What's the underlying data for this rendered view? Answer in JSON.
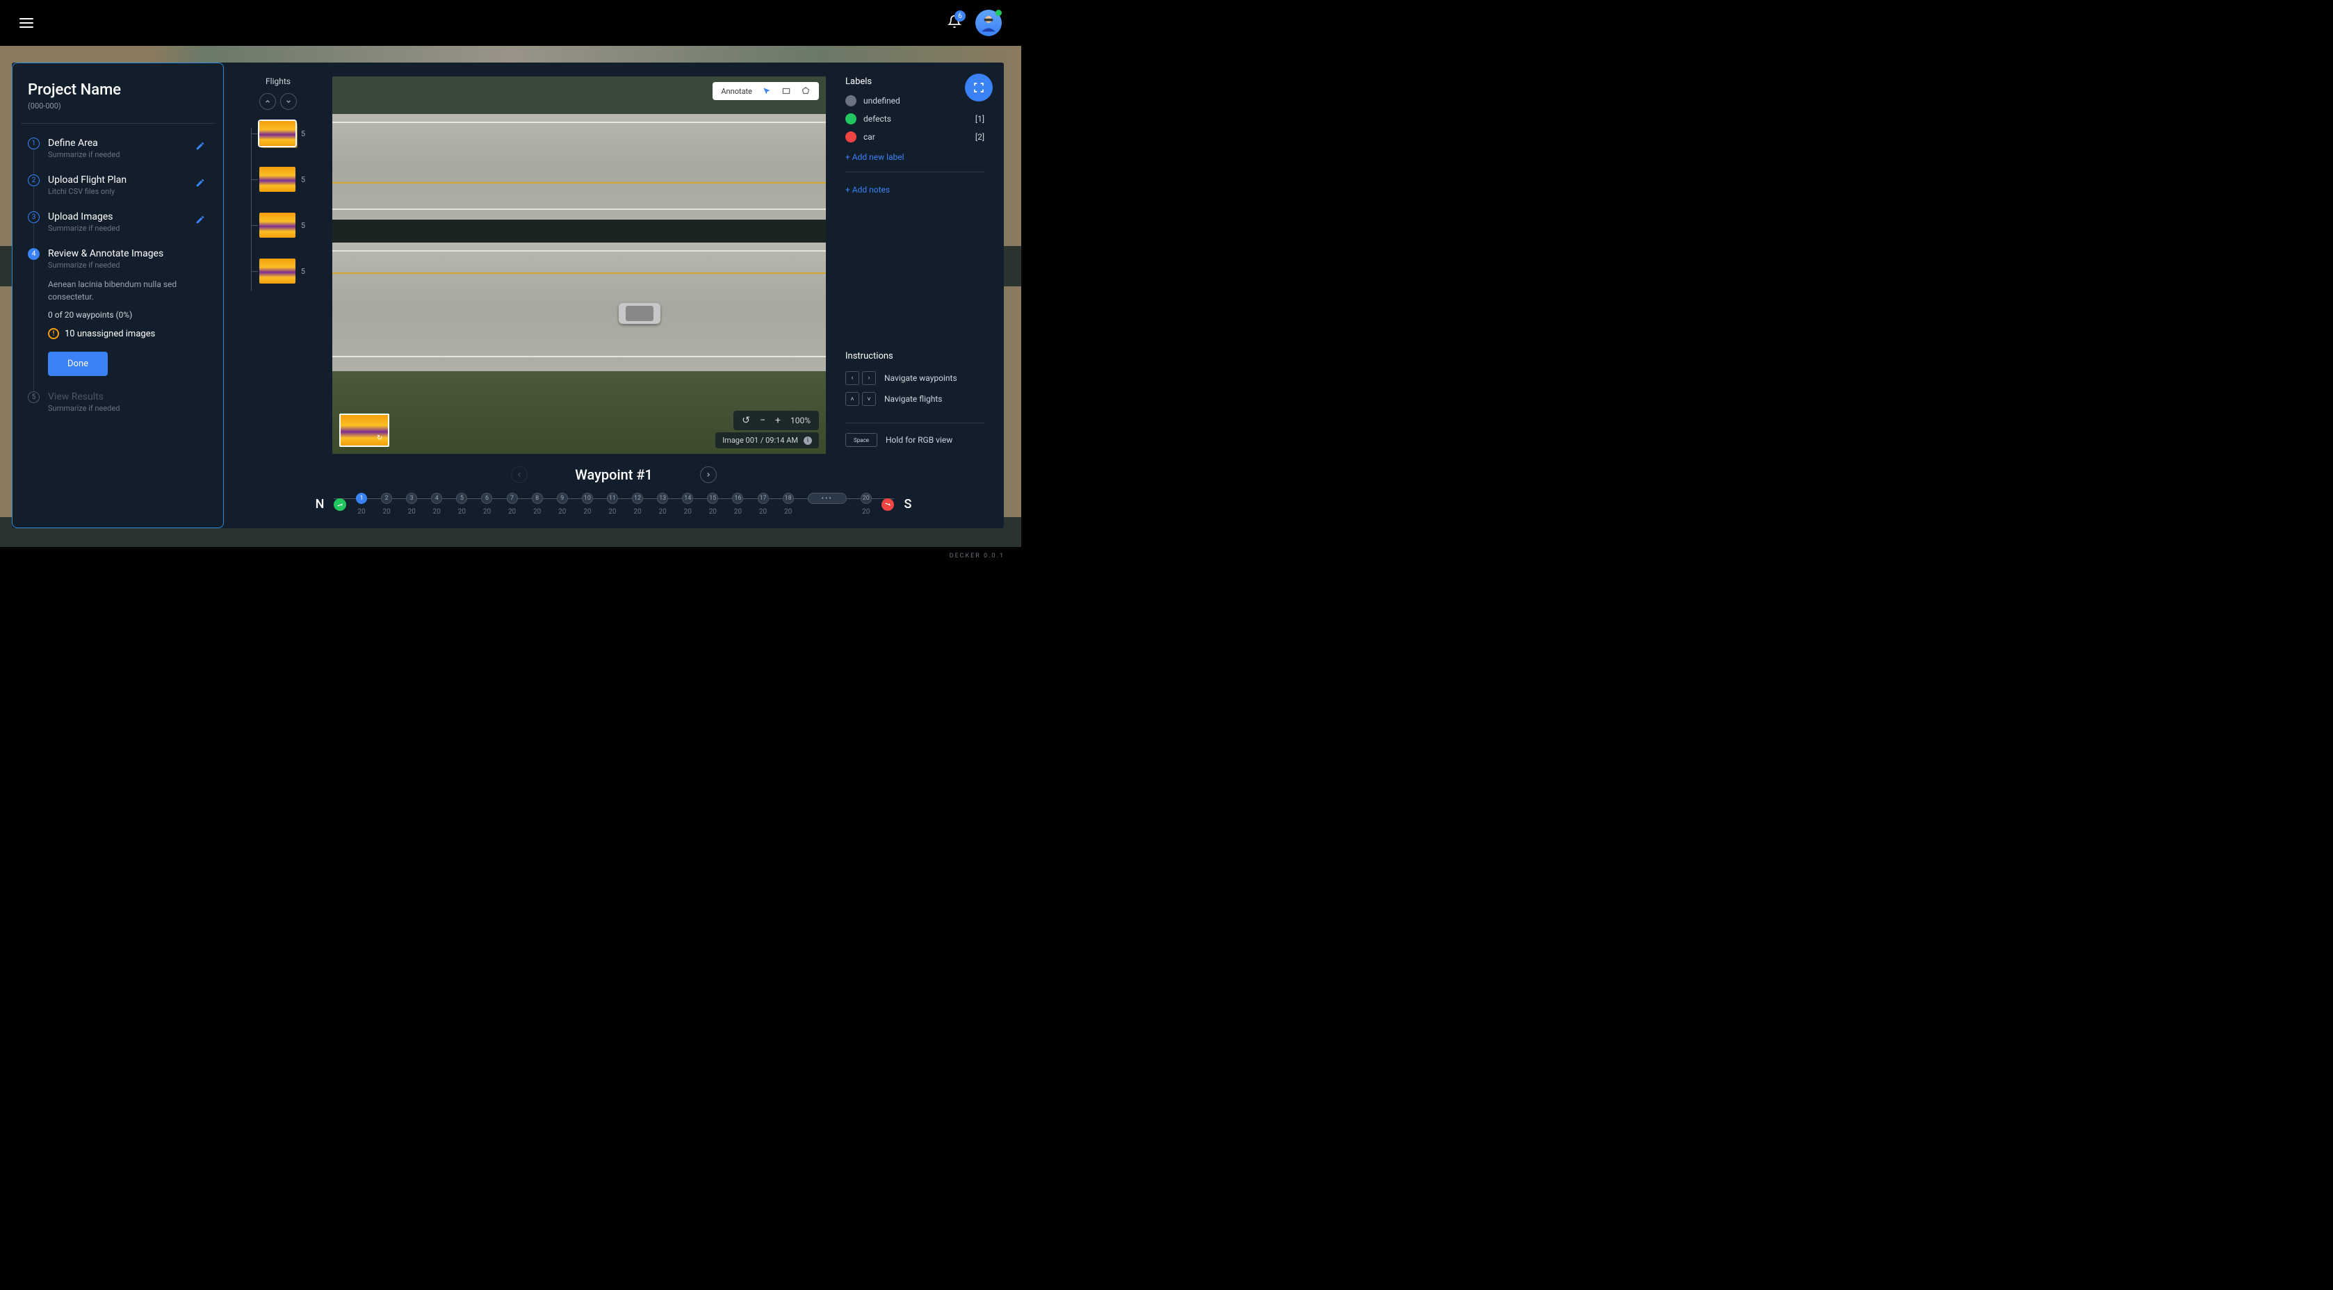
{
  "topbar": {
    "notification_count": "6"
  },
  "sidebar": {
    "project_title": "Project Name",
    "project_sub": "(000-000)",
    "steps": [
      {
        "num": "1",
        "title": "Define Area",
        "sub": "Summarize if needed"
      },
      {
        "num": "2",
        "title": "Upload Flight Plan",
        "sub": "Litchi CSV files only"
      },
      {
        "num": "3",
        "title": "Upload Images",
        "sub": "Summarize if needed"
      },
      {
        "num": "4",
        "title": "Review & Annotate Images",
        "sub": "Summarize if needed",
        "detail": "Aenean lacinia bibendum nulla sed consectetur.",
        "progress": "0 of 20 waypoints (0%)",
        "warning": "10 unassigned images",
        "done_label": "Done"
      },
      {
        "num": "5",
        "title": "View Results",
        "sub": "Summarize if needed"
      }
    ]
  },
  "flights": {
    "title": "Flights",
    "items": [
      {
        "count": "5",
        "selected": true
      },
      {
        "count": "5",
        "selected": false
      },
      {
        "count": "5",
        "selected": false
      },
      {
        "count": "5",
        "selected": false
      }
    ]
  },
  "viewer": {
    "annotate_label": "Annotate",
    "zoom_level": "100%",
    "meta": "Image 001 / 09:14 AM"
  },
  "labels": {
    "title": "Labels",
    "items": [
      {
        "name": "undefined",
        "color": "#6b7280",
        "count": ""
      },
      {
        "name": "defects",
        "color": "#22c55e",
        "count": "[1]"
      },
      {
        "name": "car",
        "color": "#ef4444",
        "count": "[2]"
      }
    ],
    "add_label": "+ Add new label",
    "add_notes": "+ Add notes"
  },
  "instructions": {
    "title": "Instructions",
    "nav_waypoints": "Navigate waypoints",
    "nav_flights": "Navigate flights",
    "space_key": "Space",
    "rgb_view": "Hold for RGB view"
  },
  "waypoint": {
    "title": "Waypoint #1"
  },
  "timeline": {
    "start": "N",
    "end": "S",
    "points": [
      {
        "n": "1",
        "v": "20",
        "active": true
      },
      {
        "n": "2",
        "v": "20"
      },
      {
        "n": "3",
        "v": "20"
      },
      {
        "n": "4",
        "v": "20"
      },
      {
        "n": "5",
        "v": "20"
      },
      {
        "n": "6",
        "v": "20"
      },
      {
        "n": "7",
        "v": "20"
      },
      {
        "n": "8",
        "v": "20"
      },
      {
        "n": "9",
        "v": "20"
      },
      {
        "n": "10",
        "v": "20"
      },
      {
        "n": "11",
        "v": "20"
      },
      {
        "n": "12",
        "v": "20"
      },
      {
        "n": "13",
        "v": "20"
      },
      {
        "n": "14",
        "v": "20"
      },
      {
        "n": "15",
        "v": "20"
      },
      {
        "n": "16",
        "v": "20"
      },
      {
        "n": "17",
        "v": "20"
      },
      {
        "n": "18",
        "v": "20"
      }
    ],
    "last": {
      "n": "20",
      "v": "20"
    }
  },
  "footer": {
    "version": "DECKER 0.0.1"
  }
}
